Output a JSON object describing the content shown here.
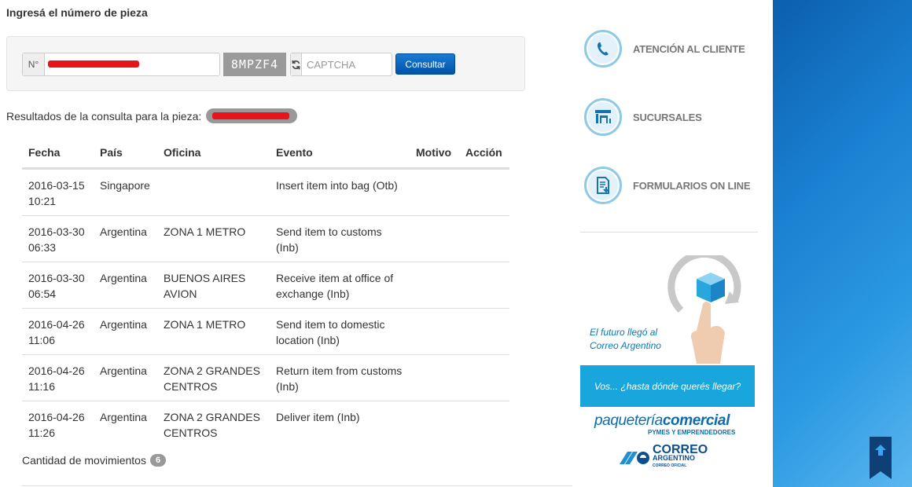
{
  "page": {
    "title": "Ingresá el número de pieza"
  },
  "form": {
    "number_prefix": "N°",
    "number_value": "",
    "captcha_text": "8MPZF4",
    "captcha_placeholder": "CAPTCHA",
    "submit_label": "Consultar"
  },
  "results": {
    "label": "Resultados de la consulta para la pieza:",
    "headers": [
      "Fecha",
      "País",
      "Oficina",
      "Evento",
      "Motivo",
      "Acción"
    ],
    "rows": [
      {
        "fecha": "2016-03-15 10:21",
        "pais": "Singapore",
        "oficina": "",
        "evento": "Insert item into bag (Otb)",
        "motivo": "",
        "accion": ""
      },
      {
        "fecha": "2016-03-30 06:33",
        "pais": "Argentina",
        "oficina": "ZONA 1 METRO",
        "evento": "Send item to customs (Inb)",
        "motivo": "",
        "accion": ""
      },
      {
        "fecha": "2016-03-30 06:54",
        "pais": "Argentina",
        "oficina": "BUENOS AIRES AVION",
        "evento": "Receive item at office of exchange (Inb)",
        "motivo": "",
        "accion": ""
      },
      {
        "fecha": "2016-04-26 11:06",
        "pais": "Argentina",
        "oficina": "ZONA 1 METRO",
        "evento": "Send item to domestic location (Inb)",
        "motivo": "",
        "accion": ""
      },
      {
        "fecha": "2016-04-26 11:16",
        "pais": "Argentina",
        "oficina": "ZONA 2 GRANDES CENTROS",
        "evento": "Return item from customs (Inb)",
        "motivo": "",
        "accion": ""
      },
      {
        "fecha": "2016-04-26 11:26",
        "pais": "Argentina",
        "oficina": "ZONA 2 GRANDES CENTROS",
        "evento": "Deliver item (Inb)",
        "motivo": "",
        "accion": ""
      }
    ],
    "count_label": "Cantidad de movimientos",
    "count_value": "6"
  },
  "sidebar": {
    "links": [
      {
        "label": "ATENCIÓN AL CLIENTE",
        "icon": "phone-icon"
      },
      {
        "label": "SUCURSALES",
        "icon": "branch-icon"
      },
      {
        "label": "FORMULARIOS ON LINE",
        "icon": "form-icon"
      }
    ],
    "promo": {
      "tagline_1": "El futuro llegó al",
      "tagline_2": "Correo Argentino",
      "band": "Vos... ¿hasta dónde querés llegar?",
      "brand_light": "paquetería",
      "brand_bold": "comercial",
      "brand_sub": "PYMES Y EMPRENDEDORES",
      "logo_line1": "CORREO",
      "logo_line2": "ARGENTINO",
      "logo_line3": "CORREO OFICIAL"
    }
  },
  "colors": {
    "accent": "#0053a8",
    "redaction": "#e8141b",
    "sidebar_icon_ring": "#8ecae6",
    "promo_band": "#19a6dc",
    "right_panel": "#1a7fd0"
  }
}
